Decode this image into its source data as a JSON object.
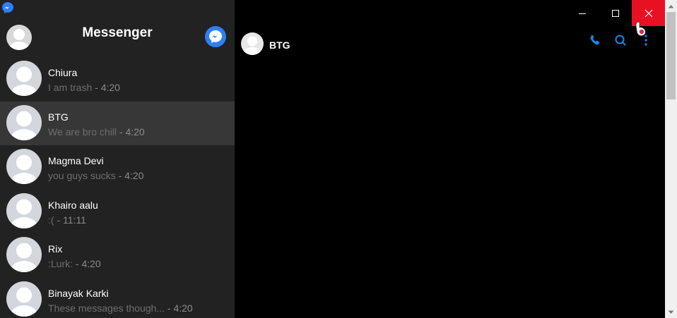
{
  "sidebar": {
    "title": "Messenger"
  },
  "conversations": [
    {
      "name": "Chiura",
      "message": "I am trash",
      "time": "4:20",
      "active": false
    },
    {
      "name": "BTG",
      "message": "We are bro chill",
      "time": "4:20",
      "active": true
    },
    {
      "name": "Magma Devi",
      "message": "you guys sucks",
      "time": "4:20",
      "active": false
    },
    {
      "name": "Khairo aalu",
      "message": ":(",
      "time": "11:11",
      "active": false
    },
    {
      "name": "Rix",
      "message": ":Lurk:",
      "time": "4:20",
      "active": false
    },
    {
      "name": "Binayak Karki",
      "message": "These messages though...",
      "time": "4:20",
      "active": false
    }
  ],
  "chat": {
    "title": "BTG"
  },
  "icons": {
    "app": "messenger-logo-icon",
    "compose": "messenger-compose-icon",
    "call": "phone-icon",
    "search": "search-icon",
    "more": "more-vertical-icon"
  },
  "colors": {
    "sidebar_bg": "#222222",
    "active_row": "#373737",
    "accent_blue": "#2f7ff2",
    "header_icon": "#0e8de6",
    "close_red": "#e81123"
  }
}
